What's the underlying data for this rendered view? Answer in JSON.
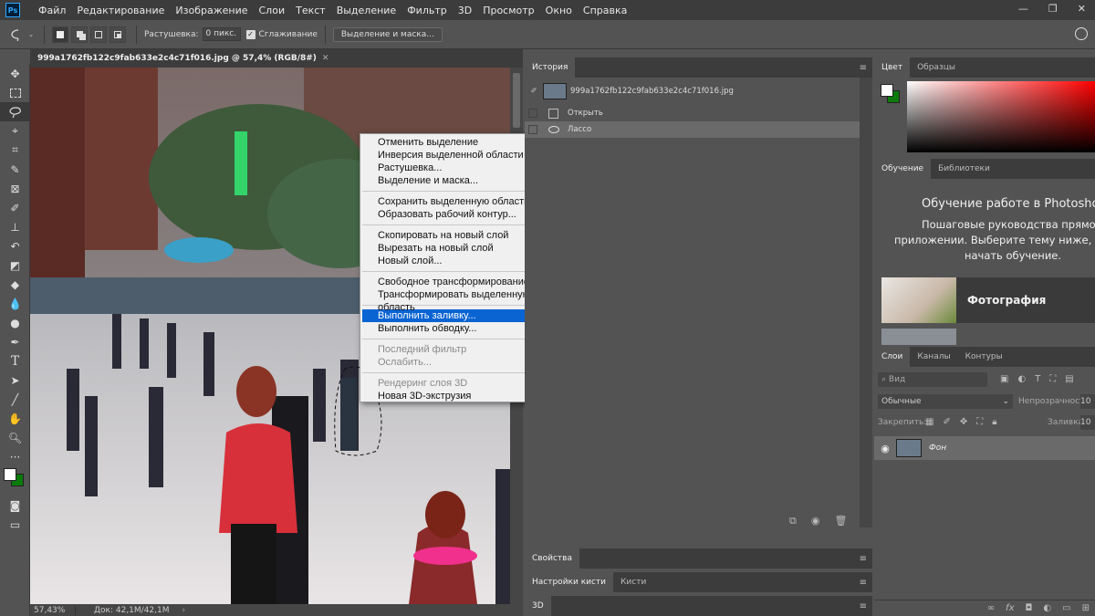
{
  "app": {
    "logo": "Ps"
  },
  "menu": [
    "Файл",
    "Редактирование",
    "Изображение",
    "Слои",
    "Текст",
    "Выделение",
    "Фильтр",
    "3D",
    "Просмотр",
    "Окно",
    "Справка"
  ],
  "window_buttons": [
    "—",
    "❐",
    "✕"
  ],
  "options": {
    "feather_label": "Растушевка:",
    "feather_value": "0 пикс.",
    "antialias_label": "Сглаживание",
    "antialias_checked": true,
    "select_mask_label": "Выделение и маска..."
  },
  "document": {
    "tab_title": "999a1762fb122c9fab633e2c4c71f016.jpg @ 57,4% (RGB/8#)",
    "zoom": "57,43%",
    "doc_info": "Док: 42,1M/42,1M"
  },
  "context_menu": {
    "groups": [
      [
        {
          "label": "Отменить выделение",
          "enabled": true
        },
        {
          "label": "Инверсия выделенной области",
          "enabled": true
        },
        {
          "label": "Растушевка...",
          "enabled": true
        },
        {
          "label": "Выделение и маска...",
          "enabled": true
        }
      ],
      [
        {
          "label": "Сохранить выделенную область...",
          "enabled": true
        },
        {
          "label": "Образовать рабочий контур...",
          "enabled": true
        }
      ],
      [
        {
          "label": "Скопировать на новый слой",
          "enabled": true
        },
        {
          "label": "Вырезать на новый слой",
          "enabled": true
        },
        {
          "label": "Новый слой...",
          "enabled": true
        }
      ],
      [
        {
          "label": "Свободное трансформирование",
          "enabled": true
        },
        {
          "label": "Трансформировать выделенную область",
          "enabled": true
        }
      ],
      [
        {
          "label": "Выполнить заливку...",
          "enabled": true,
          "highlighted": true
        },
        {
          "label": "Выполнить обводку...",
          "enabled": true
        }
      ],
      [
        {
          "label": "Последний фильтр",
          "enabled": false
        },
        {
          "label": "Ослабить...",
          "enabled": false
        }
      ],
      [
        {
          "label": "Рендеринг слоя 3D",
          "enabled": false
        },
        {
          "label": "Новая 3D-экструзия",
          "enabled": true
        }
      ]
    ]
  },
  "history": {
    "tab": "История",
    "snapshot": "999a1762fb122c9fab633e2c4c71f016.jpg",
    "items": [
      "Открыть",
      "Лассо"
    ]
  },
  "color_panel": {
    "tabs": [
      "Цвет",
      "Образцы"
    ],
    "hue_color": "#ff0000"
  },
  "learn_panel": {
    "tabs": [
      "Обучение",
      "Библиотеки"
    ],
    "title": "Обучение работе в Photoshop",
    "desc_lines": [
      "Пошаговые руководства прямо в",
      "приложении. Выберите тему ниже, что",
      "начать обучение."
    ],
    "card_label": "Фотография"
  },
  "bottom_panels": {
    "properties": "Свойства",
    "brush_tabs": [
      "Настройки кисти",
      "Кисти"
    ],
    "three_d": "3D"
  },
  "layers": {
    "tabs": [
      "Слои",
      "Каналы",
      "Контуры"
    ],
    "search_placeholder": "Вид",
    "blend_mode": "Обычные",
    "opacity_label": "Непрозрачность:",
    "opacity_value": "10",
    "lock_label": "Закрепить:",
    "fill_label": "Заливка:",
    "fill_value": "10",
    "layer_name": "Фон"
  },
  "colors": {
    "foreground": "#ffffff",
    "background": "#0b7a0b",
    "highlight": "#0a64d2"
  }
}
